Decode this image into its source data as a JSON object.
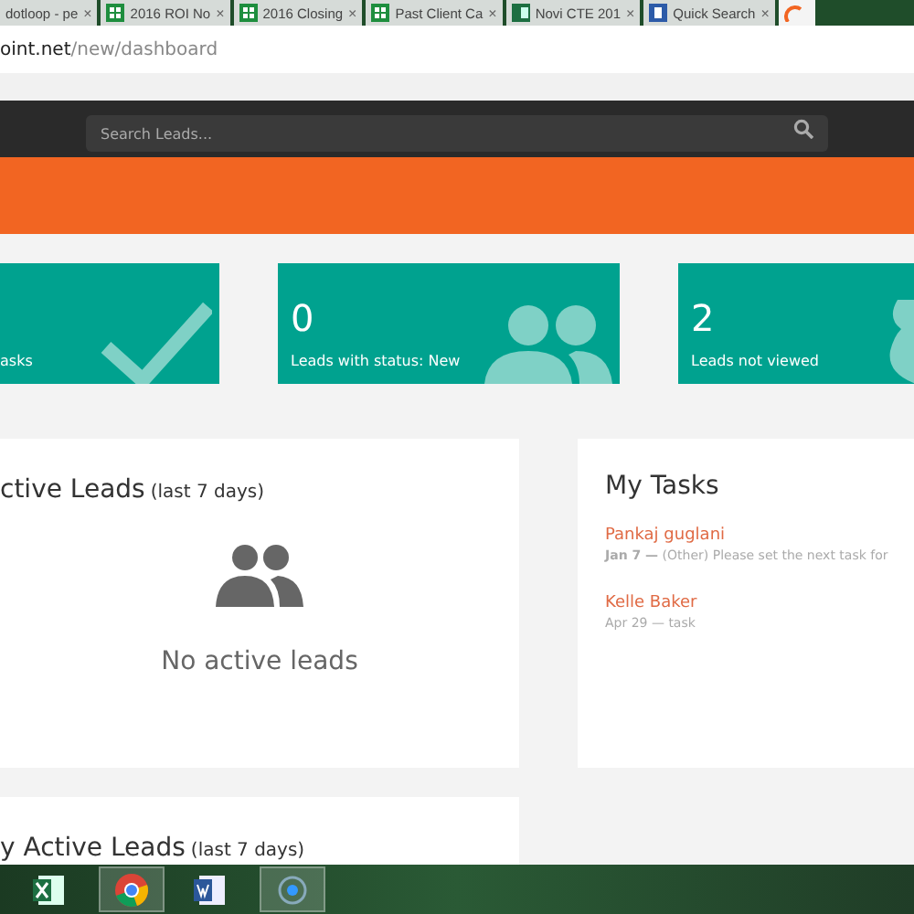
{
  "browser": {
    "tabs": [
      {
        "label": "dotloop - pe",
        "kind": "none",
        "selected": false
      },
      {
        "label": "2016 ROI No",
        "kind": "sheet",
        "selected": false
      },
      {
        "label": "2016 Closing",
        "kind": "sheet",
        "selected": false
      },
      {
        "label": "Past Client Ca",
        "kind": "sheet",
        "selected": false
      },
      {
        "label": "Novi CTE 201",
        "kind": "excel",
        "selected": false
      },
      {
        "label": "Quick Search",
        "kind": "page",
        "selected": false
      },
      {
        "kind": "orange",
        "selected": true
      }
    ],
    "close_glyph": "×",
    "url_host": "oint.net",
    "url_path": "/new/dashboard"
  },
  "nav": {
    "search": {
      "placeholder": "Search Leads..."
    }
  },
  "stat_cards": [
    {
      "label": "asks"
    },
    {
      "value": "0",
      "label": "Leads with status: New"
    },
    {
      "value": "2",
      "label": "Leads not viewed"
    }
  ],
  "active_leads": {
    "title": "ctive Leads",
    "note": "(last 7 days)",
    "empty": "No active leads"
  },
  "my_tasks": {
    "title": "My Tasks",
    "tasks": [
      {
        "name": "Pankaj guglani",
        "meta": "**Jan 7 —** (Other) Please set the next task for"
      },
      {
        "name": "Kelle Baker",
        "meta": "Apr 29 — task"
      }
    ]
  },
  "second_panel": {
    "title": "y Active Leads",
    "note": "(last 7 days)"
  },
  "taskbar": {
    "apps": [
      {
        "kind": "excel",
        "selected": false
      },
      {
        "kind": "chrome",
        "selected": true
      },
      {
        "kind": "word",
        "selected": false
      },
      {
        "kind": "circle",
        "selected": true
      }
    ]
  }
}
